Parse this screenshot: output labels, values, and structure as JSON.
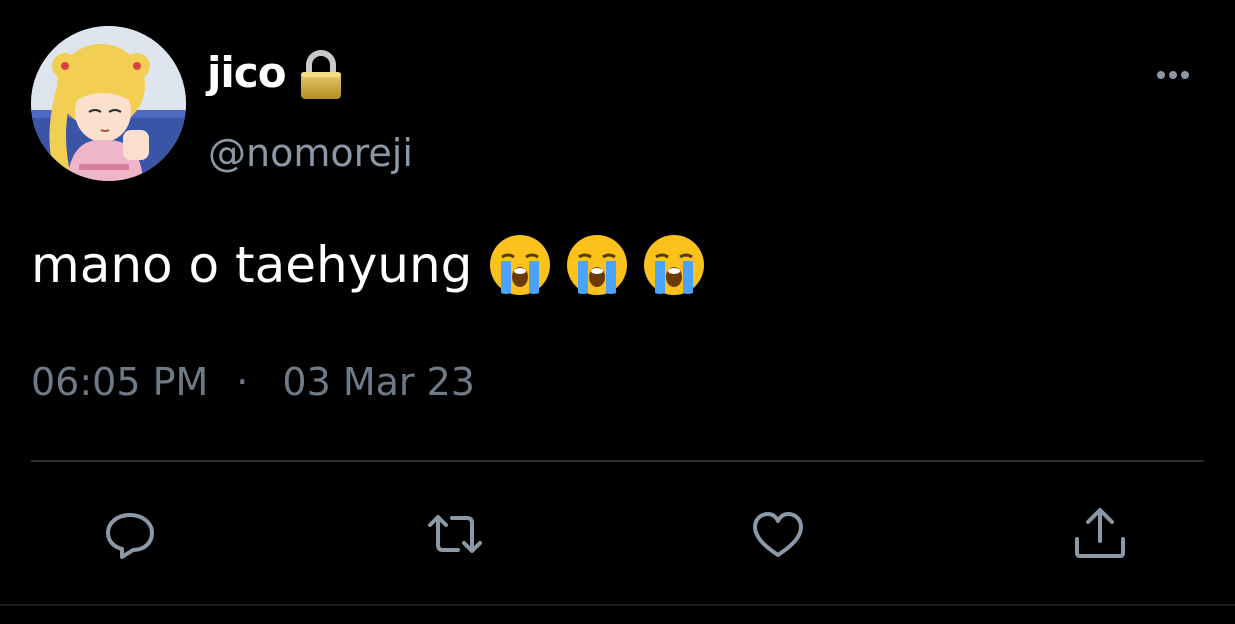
{
  "tweet": {
    "display_name": "jico",
    "handle": "@nomoreji",
    "text": "mano o taehyung",
    "emojis": [
      "loudly-crying-face",
      "loudly-crying-face",
      "loudly-crying-face"
    ],
    "time": "06:05 PM",
    "separator": "·",
    "date": "03 Mar 23",
    "protected": true
  },
  "icons": {
    "lock": "lock-icon",
    "more": "more-horizontal-icon",
    "actions": [
      "reply-icon",
      "retweet-icon",
      "like-icon",
      "share-icon"
    ]
  },
  "colors": {
    "background": "#000000",
    "text": "#ffffff",
    "secondary_text": "#8b98a5",
    "icon": "#8b98a5",
    "divider": "#2a2d31"
  }
}
